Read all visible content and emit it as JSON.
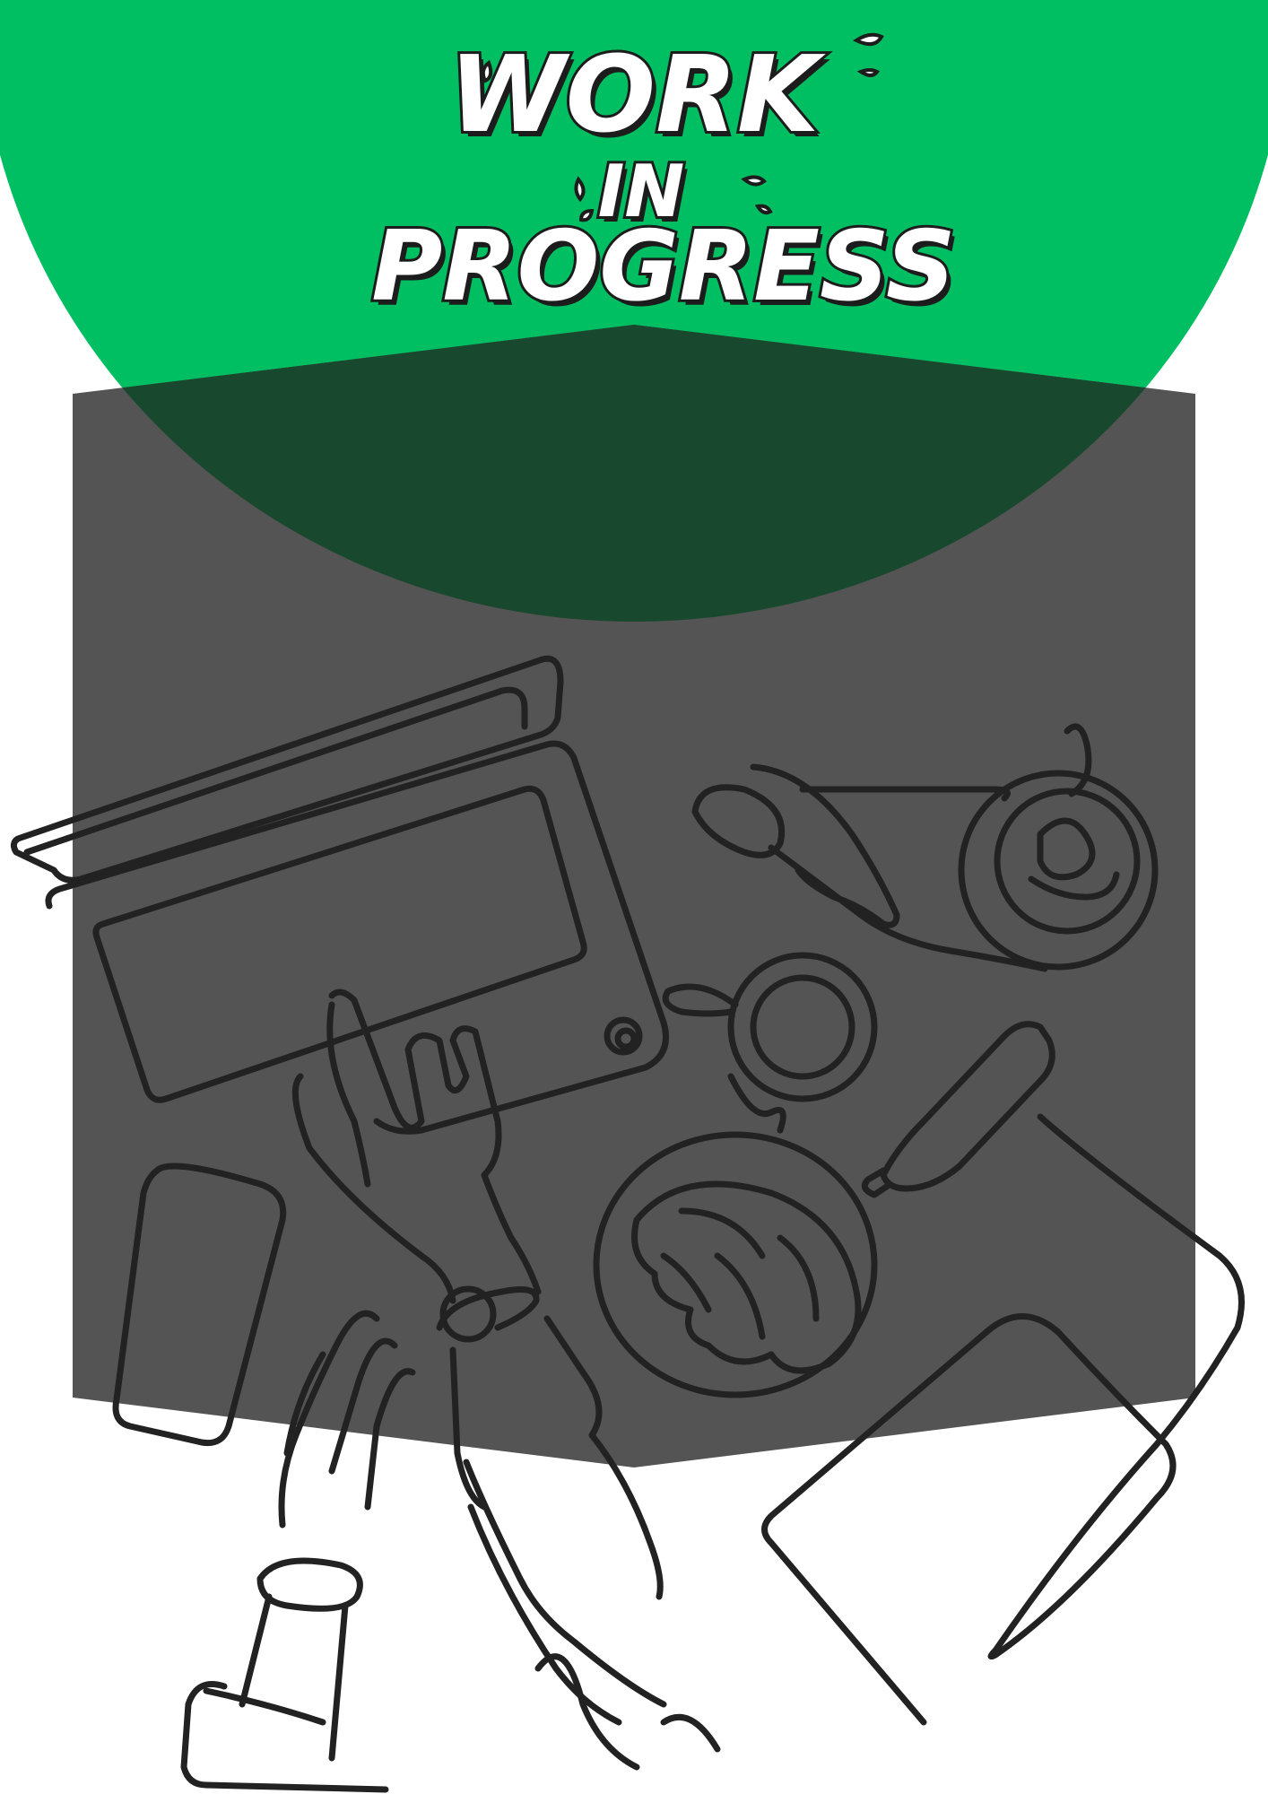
{
  "title": {
    "line1": "WORK",
    "line2": "IN",
    "line3": "PROGRESS"
  },
  "colors": {
    "background": "#ffffff",
    "green": "#00bf63",
    "dark_green": "#18482e",
    "panel_gray": "#545454",
    "ink": "#222222"
  },
  "illustration": {
    "subject": "continuous-line drawing of hands typing on a laptop beside a coffee cup, croissant plate, bottle and salad bowl"
  }
}
